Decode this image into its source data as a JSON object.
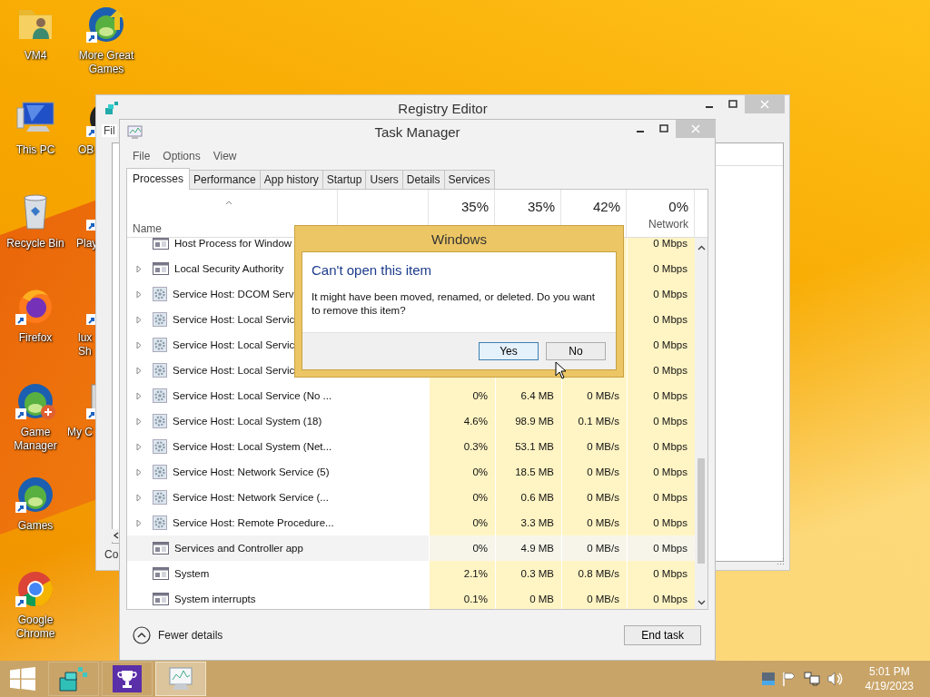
{
  "desktop": {
    "icons": [
      {
        "label": "VM4",
        "kind": "folder-user",
        "shortcut": false
      },
      {
        "label": "This PC",
        "kind": "computer",
        "shortcut": false
      },
      {
        "label": "Recycle Bin",
        "kind": "recycle-bin",
        "shortcut": false
      },
      {
        "label": "Firefox",
        "kind": "fox-browser",
        "shortcut": true
      },
      {
        "label": "Game Manager",
        "kind": "game-plus",
        "shortcut": true
      },
      {
        "label": "Games",
        "kind": "game",
        "shortcut": true
      },
      {
        "label": "Google Chrome",
        "kind": "round-browser",
        "shortcut": true
      }
    ],
    "icons_second_column": [
      {
        "label": "More Great Games",
        "kind": "game-arrow",
        "shortcut": true
      },
      {
        "label": "OB",
        "kind": "dark-circle",
        "shortcut": true
      },
      {
        "label": "Play",
        "kind": "dark-figure",
        "shortcut": true
      },
      {
        "label": "lux",
        "label_2": "Sh",
        "kind": "dark-figure",
        "shortcut": true
      },
      {
        "label": "My C",
        "kind": "gray-box",
        "shortcut": true
      }
    ]
  },
  "registry_editor": {
    "title": "Registry Editor",
    "menu_fragment": "Fil",
    "status_fragment": "Co"
  },
  "task_manager": {
    "title": "Task Manager",
    "menu": [
      "File",
      "Options",
      "View"
    ],
    "tabs": [
      {
        "label": "Processes",
        "selected": true
      },
      {
        "label": "Performance",
        "selected": false
      },
      {
        "label": "App history",
        "selected": false
      },
      {
        "label": "Startup",
        "selected": false
      },
      {
        "label": "Users",
        "selected": false
      },
      {
        "label": "Details",
        "selected": false
      },
      {
        "label": "Services",
        "selected": false
      }
    ],
    "header": {
      "name": "Name",
      "cpu_total": "35%",
      "memory_total": "35%",
      "disk_total": "42%",
      "network_total": "0%",
      "network": "Network"
    },
    "rows": [
      {
        "name": "Host Process for Window",
        "kind": "app",
        "expandable": false,
        "selected": false,
        "network": "0 Mbps"
      },
      {
        "name": "Local Security Authority",
        "kind": "app",
        "expandable": true,
        "selected": false,
        "network": "0 Mbps"
      },
      {
        "name": "Service Host: DCOM Serv",
        "kind": "service",
        "expandable": true,
        "selected": false,
        "network": "0 Mbps"
      },
      {
        "name": "Service Host: Local Servic",
        "kind": "service",
        "expandable": true,
        "selected": false,
        "network": "0 Mbps"
      },
      {
        "name": "Service Host: Local Servic",
        "kind": "service",
        "expandable": true,
        "selected": false,
        "network": "0 Mbps"
      },
      {
        "name": "Service Host: Local Servic",
        "kind": "service",
        "expandable": true,
        "selected": false,
        "network": "0 Mbps"
      },
      {
        "name": "Service Host: Local Service (No ...",
        "kind": "service",
        "expandable": true,
        "selected": false,
        "cpu": "0%",
        "memory": "6.4 MB",
        "disk": "0 MB/s",
        "network": "0 Mbps"
      },
      {
        "name": "Service Host: Local System (18)",
        "kind": "service",
        "expandable": true,
        "selected": false,
        "cpu": "4.6%",
        "memory": "98.9 MB",
        "disk": "0.1 MB/s",
        "network": "0 Mbps"
      },
      {
        "name": "Service Host: Local System (Net...",
        "kind": "service",
        "expandable": true,
        "selected": false,
        "cpu": "0.3%",
        "memory": "53.1 MB",
        "disk": "0 MB/s",
        "network": "0 Mbps"
      },
      {
        "name": "Service Host: Network Service (5)",
        "kind": "service",
        "expandable": true,
        "selected": false,
        "cpu": "0%",
        "memory": "18.5 MB",
        "disk": "0 MB/s",
        "network": "0 Mbps"
      },
      {
        "name": "Service Host: Network Service (...",
        "kind": "service",
        "expandable": true,
        "selected": false,
        "cpu": "0%",
        "memory": "0.6 MB",
        "disk": "0 MB/s",
        "network": "0 Mbps"
      },
      {
        "name": "Service Host: Remote Procedure...",
        "kind": "service",
        "expandable": true,
        "selected": false,
        "cpu": "0%",
        "memory": "3.3 MB",
        "disk": "0 MB/s",
        "network": "0 Mbps"
      },
      {
        "name": "Services and Controller app",
        "kind": "app",
        "expandable": false,
        "selected": true,
        "cpu": "0%",
        "memory": "4.9 MB",
        "disk": "0 MB/s",
        "network": "0 Mbps"
      },
      {
        "name": "System",
        "kind": "app",
        "expandable": false,
        "selected": false,
        "cpu": "2.1%",
        "memory": "0.3 MB",
        "disk": "0.8 MB/s",
        "network": "0 Mbps"
      },
      {
        "name": "System interrupts",
        "kind": "app",
        "expandable": false,
        "selected": false,
        "cpu": "0.1%",
        "memory": "0 MB",
        "disk": "0 MB/s",
        "network": "0 Mbps"
      }
    ],
    "fewer_details": "Fewer details",
    "end_task": "End task"
  },
  "dialog": {
    "title": "Windows",
    "heading": "Can't open this item",
    "message": "It might have been moved, renamed, or deleted. Do you want to remove this item?",
    "buttons": [
      {
        "label": "Yes",
        "default": true
      },
      {
        "label": "No",
        "default": false
      }
    ]
  },
  "taskbar": {
    "apps": [
      {
        "kind": "registry",
        "active": false
      },
      {
        "kind": "trophy",
        "active": false
      },
      {
        "kind": "task-manager",
        "active": true
      }
    ],
    "time": "5:01 PM",
    "date": "4/19/2023"
  }
}
